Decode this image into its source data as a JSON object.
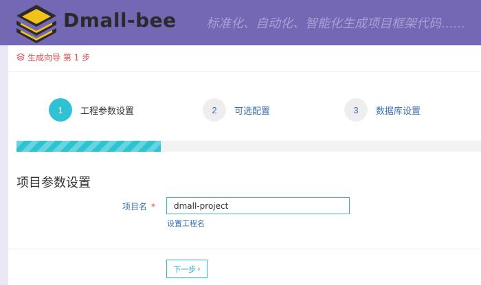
{
  "header": {
    "brand": "Dmall-bee",
    "slogan": "标准化、自动化、智能化生成项目框架代码......",
    "logo_icon": "stacked-layers-logo",
    "colors": {
      "background": "#7467b3",
      "logo_dark": "#2b2b2b",
      "logo_yellow": "#f2c21a"
    }
  },
  "breadcrumb": {
    "icon": "layers-icon",
    "text": "生成向导 第 1 步",
    "color": "#e0484d"
  },
  "steps": [
    {
      "number": "1",
      "label": "工程参数设置",
      "state": "active"
    },
    {
      "number": "2",
      "label": "可选配置",
      "state": "inactive"
    },
    {
      "number": "3",
      "label": "数据库设置",
      "state": "inactive"
    }
  ],
  "progress": {
    "current_step": 1,
    "total_steps": 3,
    "fraction": 0.31,
    "color": "#2ec3d4"
  },
  "form": {
    "section_title": "项目参数设置",
    "project_name": {
      "label": "项目名",
      "required_mark": "*",
      "value": "dmall-project",
      "hint": "设置工程名"
    },
    "next_button": {
      "label": "下一步",
      "icon": "chevron-right-icon",
      "icon_glyph": "›"
    }
  }
}
